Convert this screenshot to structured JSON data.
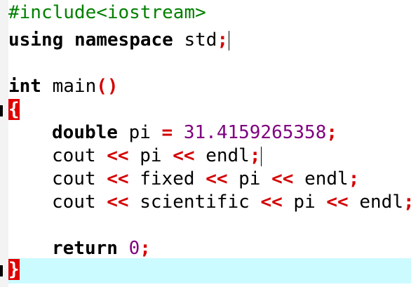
{
  "editor": {
    "lines": {
      "l1": {
        "pp": "#include<iostream>"
      },
      "l2": {
        "kw1": "using",
        "kw2": "namespace",
        "id": "std",
        "semi": ";"
      },
      "l3": {},
      "l4": {
        "type": "int",
        "name": "main",
        "paren": "()"
      },
      "l5": {
        "brace": "{"
      },
      "l6": {
        "type": "double",
        "var": "pi",
        "eq": "=",
        "num": "31.4159265358",
        "semi": ";"
      },
      "l7": {
        "w1": "cout",
        "op1": "<<",
        "w2": "pi",
        "op2": "<<",
        "w3": "endl",
        "semi": ";"
      },
      "l8": {
        "w1": "cout",
        "op1": "<<",
        "w2": "fixed",
        "op2": "<<",
        "w3": "pi",
        "op3": "<<",
        "w4": "endl",
        "semi": ";"
      },
      "l9": {
        "w1": "cout",
        "op1": "<<",
        "w2": "scientific",
        "op2": "<<",
        "w3": "pi",
        "op3": "<<",
        "w4": "endl",
        "semi": ";"
      },
      "l10": {},
      "l11": {
        "kw": "return",
        "num": "0",
        "semi": ";"
      },
      "l12": {
        "brace": "}"
      }
    },
    "colors": {
      "preprocessor": "#008000",
      "keyword": "#000000",
      "number": "#800080",
      "operator": "#d40000",
      "current_line_highlight": "#ccfbff",
      "brace_match": "#e00000"
    }
  }
}
